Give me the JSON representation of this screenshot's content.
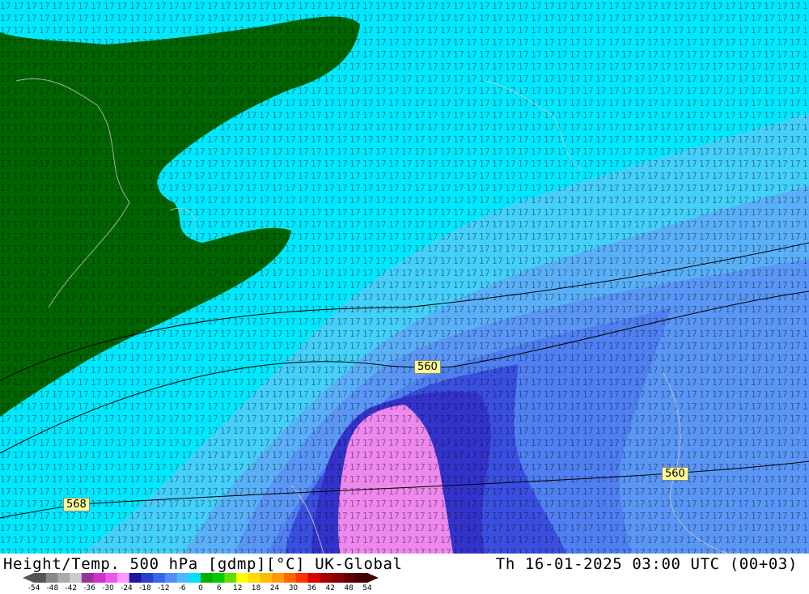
{
  "title": {
    "left": "Height/Temp. 500 hPa [gdmp][°C] UK-Global",
    "right": "Th 16-01-2025 03:00 UTC (00+03)"
  },
  "contour_labels": [
    "560",
    "560",
    "568"
  ],
  "temperature_zones": [
    {
      "band": "-30..-31",
      "color": "#ee88ee"
    },
    {
      "band": "-28..-29",
      "color": "#3333cc"
    },
    {
      "band": "-26..-27",
      "color": "#3a4fe0"
    },
    {
      "band": "-24..-25",
      "color": "#4f7ff0"
    },
    {
      "band": "-22..-23",
      "color": "#5a96f5"
    },
    {
      "band": "-19..-21",
      "color": "#5ab0f8"
    },
    {
      "band": "-17..-18",
      "color": "#44d0fa"
    },
    {
      "band": "-14..-16",
      "color": "#00e8ff"
    }
  ],
  "land_color": "#006400",
  "colorbar": {
    "colors": [
      "#555555",
      "#888888",
      "#aaaaaa",
      "#cccccc",
      "#993399",
      "#cc33cc",
      "#ee55ee",
      "#ff99ff",
      "#1a1aa0",
      "#2a3fd0",
      "#3a66ee",
      "#4f8ff8",
      "#4fb8ff",
      "#00e0ff",
      "#00b000",
      "#00cc00",
      "#66dd00",
      "#ffff00",
      "#ffdd00",
      "#ffbb00",
      "#ff9900",
      "#ff6600",
      "#ff3300",
      "#dd0000",
      "#aa0000",
      "#880000",
      "#660000",
      "#440000"
    ],
    "ticks": [
      "-54",
      "-48",
      "-42",
      "-36",
      "-30",
      "-24",
      "-18",
      "-12",
      "-6",
      "0",
      "6",
      "12",
      "18",
      "24",
      "30",
      "36",
      "42",
      "48",
      "54"
    ]
  }
}
